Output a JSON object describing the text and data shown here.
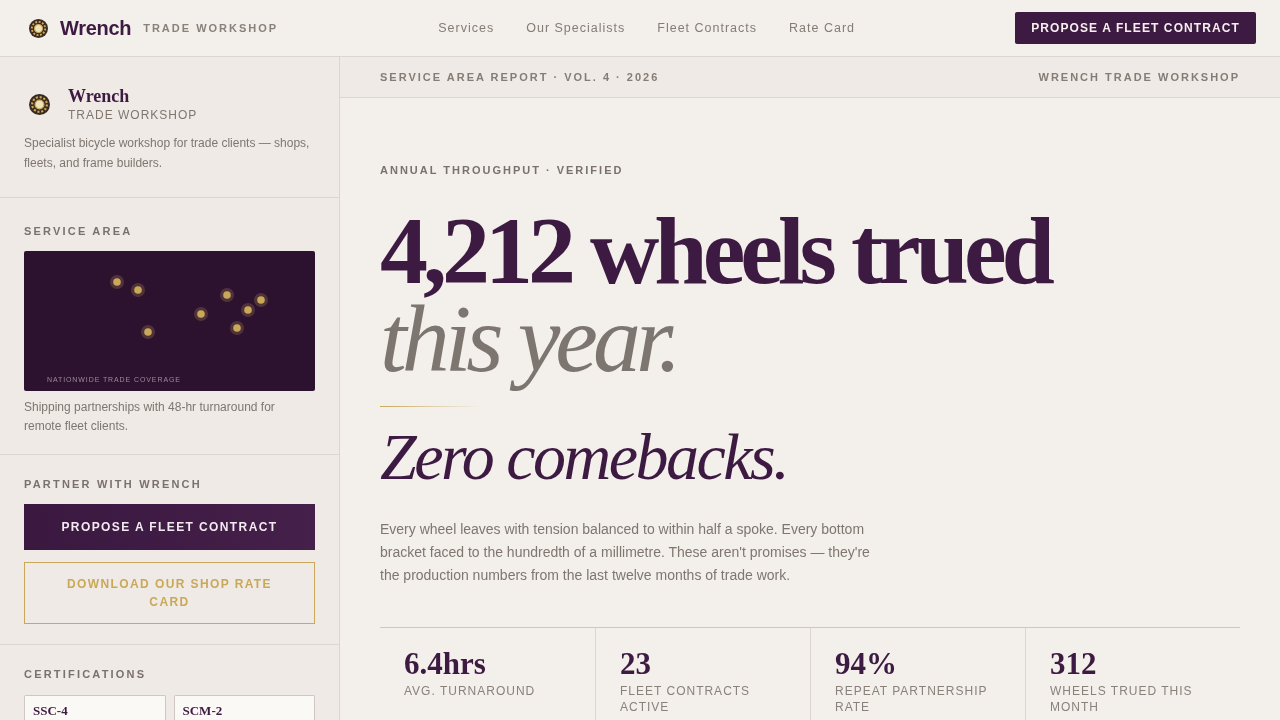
{
  "nav": {
    "brand": {
      "name": "Wrench",
      "tagline": "TRADE WORKSHOP"
    },
    "links": [
      {
        "label": "Services"
      },
      {
        "label": "Our Specialists"
      },
      {
        "label": "Fleet Contracts"
      },
      {
        "label": "Rate Card"
      }
    ],
    "cta": "PROPOSE A FLEET CONTRACT"
  },
  "sidebar": {
    "brand": {
      "name": "Wrench",
      "tagline": "TRADE WORKSHOP",
      "description": "Specialist bicycle workshop for trade clients — shops, fleets, and frame builders."
    },
    "service_area": {
      "heading": "SERVICE AREA",
      "map_caption": "NATIONWIDE TRADE COVERAGE",
      "note": "Shipping partnerships with 48-hr turnaround for remote fleet clients."
    },
    "partner": {
      "heading": "PARTNER WITH WRENCH",
      "buttons": [
        {
          "label": "PROPOSE A FLEET CONTRACT",
          "kind": "primary"
        },
        {
          "label": "DOWNLOAD OUR SHOP RATE CARD",
          "kind": "outline"
        }
      ]
    },
    "certifications": {
      "heading": "CERTIFICATIONS",
      "items": [
        {
          "code": "SSC-4"
        },
        {
          "code": "SCM-2"
        }
      ]
    }
  },
  "report_bar": {
    "left": "SERVICE AREA REPORT · VOL. 4 · 2026",
    "right": "WRENCH TRADE WORKSHOP"
  },
  "hero": {
    "eyebrow": "ANNUAL THROUGHPUT · VERIFIED",
    "headline": "4,212 wheels trued",
    "headline_muted": "this year.",
    "subhead": "Zero comebacks.",
    "body": "Every wheel leaves with tension balanced to within half a spoke. Every bottom bracket faced to the hundredth of a millimetre. These aren't promises — they're the production numbers from the last twelve months of trade work."
  },
  "stats": [
    {
      "value": "6.4hrs",
      "label": "AVG. TURNAROUND"
    },
    {
      "value": "23",
      "label": "FLEET CONTRACTS ACTIVE"
    },
    {
      "value": "94%",
      "label": "REPEAT PARTNERSHIP RATE"
    },
    {
      "value": "312",
      "label": "WHEELS TRUED THIS MONTH"
    }
  ]
}
